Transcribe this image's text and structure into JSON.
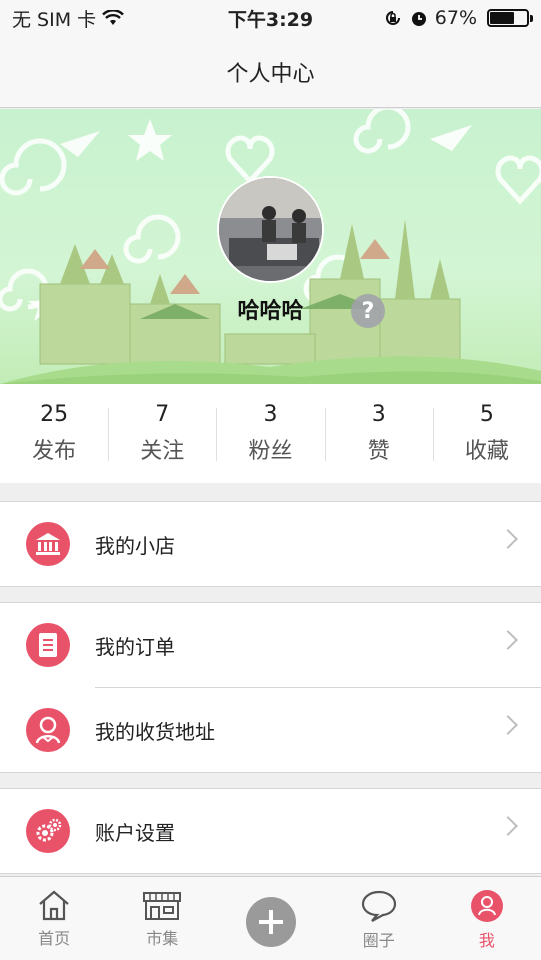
{
  "status_bar": {
    "carrier": "无 SIM 卡",
    "time": "下午3:29",
    "battery": "67%",
    "battery_level": 0.67
  },
  "nav": {
    "title": "个人中心"
  },
  "profile": {
    "username": "哈哈哈",
    "help_label": "?"
  },
  "stats": [
    {
      "value": "25",
      "label": "发布"
    },
    {
      "value": "7",
      "label": "关注"
    },
    {
      "value": "3",
      "label": "粉丝"
    },
    {
      "value": "3",
      "label": "赞"
    },
    {
      "value": "5",
      "label": "收藏"
    }
  ],
  "menu": {
    "shop": {
      "label": "我的小店",
      "icon": "bank-icon"
    },
    "orders": {
      "label": "我的订单",
      "icon": "document-icon"
    },
    "address": {
      "label": "我的收货地址",
      "icon": "person-icon"
    },
    "settings": {
      "label": "账户设置",
      "icon": "gears-icon"
    }
  },
  "tabs": [
    {
      "label": "首页",
      "icon": "home-icon"
    },
    {
      "label": "市集",
      "icon": "store-icon"
    },
    {
      "label": "",
      "icon": "plus-icon"
    },
    {
      "label": "圈子",
      "icon": "chat-icon"
    },
    {
      "label": "我",
      "icon": "user-icon",
      "active": true
    }
  ],
  "colors": {
    "accent": "#e8536a",
    "banner": "#c8f2cf"
  }
}
